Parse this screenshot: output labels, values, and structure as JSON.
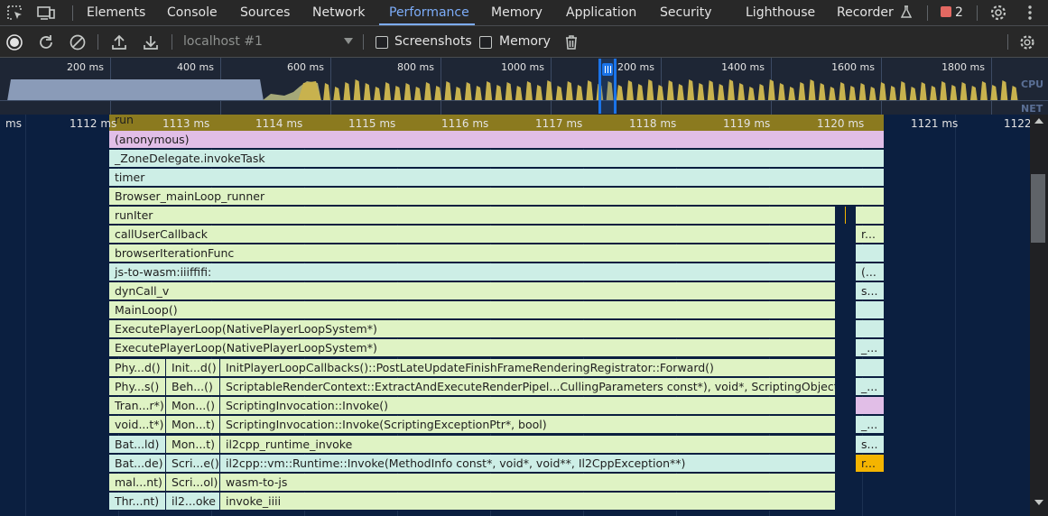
{
  "tabs": {
    "elements": "Elements",
    "console": "Console",
    "sources": "Sources",
    "network": "Network",
    "performance": "Performance",
    "memory": "Memory",
    "application": "Application",
    "security": "Security",
    "lighthouse": "Lighthouse",
    "recorder": "Recorder",
    "issues_count": "2"
  },
  "toolbar": {
    "target": "localhost #1",
    "screenshots_label": "Screenshots",
    "memory_label": "Memory"
  },
  "overview": {
    "ticks": [
      "200 ms",
      "400 ms",
      "600 ms",
      "800 ms",
      "1000 ms",
      "200 ms",
      "1400 ms",
      "1600 ms",
      "1800 ms"
    ],
    "cpu_label": "CPU",
    "net_label": "NET"
  },
  "flame": {
    "ruler": [
      "ms",
      "1112 ms",
      "1113 ms",
      "1114 ms",
      "1115 ms",
      "1116 ms",
      "1117 ms",
      "1118 ms",
      "1119 ms",
      "1120 ms",
      "1121 ms",
      "1122"
    ],
    "rows": {
      "run": "run",
      "anonymous": "(anonymous)",
      "zone": "_ZoneDelegate.invokeTask",
      "timer": "timer",
      "browser_runner": "Browser_mainLoop_runner",
      "runiter": "runIter",
      "calluser": "callUserCallback",
      "calluser_right": "r...",
      "browseriter": "browserIterationFunc",
      "jstowasm": "js-to-wasm:iiiffifi:",
      "jstowasm_right": "(...",
      "dyncall": "dynCall_v",
      "dyncall_right": "s...",
      "mainloop": "MainLoop()",
      "execute1": "ExecutePlayerLoop(NativePlayerLoopSystem*)",
      "execute2": "ExecutePlayerLoop(NativePlayerLoopSystem*)",
      "execute2_right": "_...",
      "r12_a": "Phy...d()",
      "r12_b": "Init...d()",
      "r12_c": "InitPlayerLoopCallbacks()::PostLateUpdateFinishFrameRenderingRegistrator::Forward()",
      "r13_a": "Phy...s()",
      "r13_b": "Beh...()",
      "r13_c": "ScriptableRenderContext::ExtractAndExecuteRenderPipel...CullingParameters const*), void*, ScriptingObjectPtr)",
      "r13_right": "_...",
      "r14_a": "Tran...r*)",
      "r14_b": "Mon...()",
      "r14_c": "ScriptingInvocation::Invoke()",
      "r15_a": "void...t*)",
      "r15_b": "Mon...t)",
      "r15_c": "ScriptingInvocation::Invoke(ScriptingExceptionPtr*, bool)",
      "r15_right": "_...",
      "r16_a": "Bat...ld)",
      "r16_b": "Mon...t)",
      "r16_c": "il2cpp_runtime_invoke",
      "r16_right": "s...",
      "r17_a": "Bat...de)",
      "r17_b": "Scri...e()",
      "r17_c": "il2cpp::vm::Runtime::Invoke(MethodInfo const*, void*, void**, Il2CppException**)",
      "r17_right": "r...",
      "r18_a": "mal...nt)",
      "r18_b": "Scri...ol)",
      "r18_c": "wasm-to-js",
      "r19_a": "Thr...nt)",
      "r19_b": "il2...oke",
      "r19_c": "invoke_iiii"
    }
  },
  "colors": {
    "accent": "#7cacf8",
    "run": "#8b7a1f",
    "anonymous": "#e1bee7",
    "teal": "#cdeee6",
    "green": "#dff3c4",
    "orange": "#f4b400"
  }
}
